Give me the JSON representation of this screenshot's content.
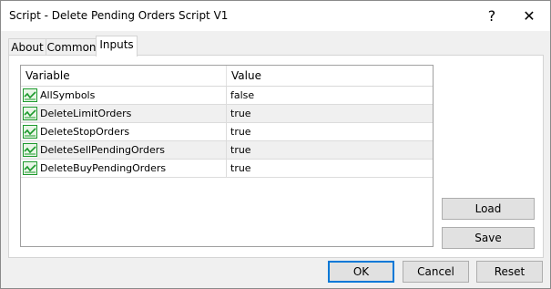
{
  "window": {
    "title": "Script - Delete Pending Orders Script V1"
  },
  "title_buttons": {
    "help": "?",
    "close": "✕"
  },
  "tabs": [
    {
      "label": "About"
    },
    {
      "label": "Common"
    },
    {
      "label": "Inputs"
    }
  ],
  "active_tab": "Inputs",
  "grid": {
    "columns": [
      "Variable",
      "Value"
    ],
    "rows": [
      {
        "variable": "AllSymbols",
        "value": "false"
      },
      {
        "variable": "DeleteLimitOrders",
        "value": "true"
      },
      {
        "variable": "DeleteStopOrders",
        "value": "true"
      },
      {
        "variable": "DeleteSellPendingOrders",
        "value": "true"
      },
      {
        "variable": "DeleteBuyPendingOrders",
        "value": "true"
      }
    ]
  },
  "side_buttons": {
    "load": "Load",
    "save": "Save"
  },
  "footer_buttons": {
    "ok": "OK",
    "cancel": "Cancel",
    "reset": "Reset"
  },
  "colors": {
    "default_button_border": "#0078d7",
    "icon_green": "#1e9a2e"
  }
}
